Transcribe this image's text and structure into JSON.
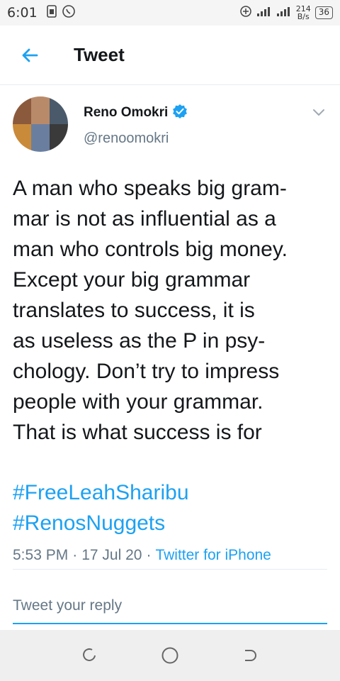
{
  "status_bar": {
    "time": "6:01",
    "net_speed_value": "214",
    "net_speed_unit": "B/s",
    "battery": "36"
  },
  "app_bar": {
    "title": "Tweet",
    "back_icon": "arrow-left-icon"
  },
  "tweet": {
    "display_name": "Reno Omokri",
    "handle": "@renoomokri",
    "verified": true,
    "body": "A man who speaks big gram-\nmar is not as influential as a\nman who controls big money.\nExcept your big grammar\ntranslates to success, it is\nas useless as the P in psy-\nchology. Don’t try to impress\npeople with your grammar.\nThat is what success is for",
    "hashtags": [
      "#FreeLeahSharibu",
      "#RenosNuggets"
    ],
    "time": "5:53 PM",
    "date": "17 Jul 20",
    "source": "Twitter for iPhone",
    "separator": "·"
  },
  "reply": {
    "placeholder": "Tweet your reply"
  },
  "colors": {
    "accent": "#1da1f2",
    "secondary_text": "#657786",
    "primary_text": "#14171a",
    "divider": "#e6ecf0"
  },
  "icons": {
    "back": "arrow-left-icon",
    "verified": "verified-badge-icon",
    "more": "chevron-down-icon",
    "nav_back": "nav-back-icon",
    "nav_home": "nav-home-icon",
    "nav_recents": "nav-recents-icon"
  }
}
